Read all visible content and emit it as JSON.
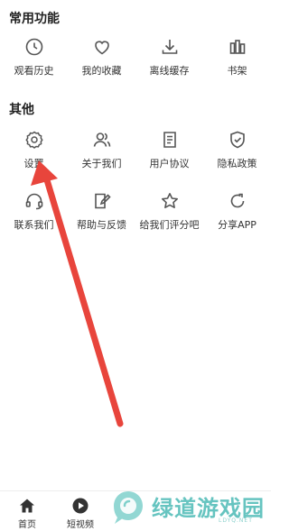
{
  "sections": {
    "common": {
      "title": "常用功能",
      "items": [
        {
          "label": "观看历史",
          "icon": "clock-icon"
        },
        {
          "label": "我的收藏",
          "icon": "heart-icon"
        },
        {
          "label": "离线缓存",
          "icon": "download-icon"
        },
        {
          "label": "书架",
          "icon": "bookshelf-icon"
        }
      ]
    },
    "other": {
      "title": "其他",
      "items": [
        {
          "label": "设置",
          "icon": "gear-icon"
        },
        {
          "label": "关于我们",
          "icon": "users-icon"
        },
        {
          "label": "用户协议",
          "icon": "document-icon"
        },
        {
          "label": "隐私政策",
          "icon": "shield-icon"
        },
        {
          "label": "联系我们",
          "icon": "headset-icon"
        },
        {
          "label": "帮助与反馈",
          "icon": "edit-icon"
        },
        {
          "label": "给我们评分吧",
          "icon": "star-icon"
        },
        {
          "label": "分享APP",
          "icon": "share-icon"
        }
      ]
    }
  },
  "bottom_nav": [
    {
      "label": "首页",
      "icon": "home-icon"
    },
    {
      "label": "短视频",
      "icon": "play-icon"
    }
  ],
  "watermark": {
    "text": "绿道游戏园",
    "sub": "LDYQ.NET",
    "color": "#66c4c0"
  },
  "annotation": {
    "arrow_color": "#e8453c",
    "points_to": "设置"
  },
  "colors": {
    "icon_stroke": "#555555",
    "text": "#333333",
    "background": "#ffffff"
  }
}
